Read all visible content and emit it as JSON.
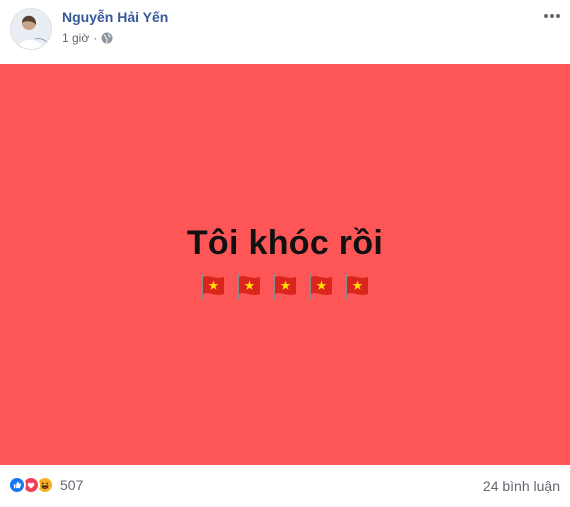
{
  "post": {
    "author": "Nguyễn Hải Yến",
    "timestamp": "1 giờ",
    "separator": "·",
    "privacy_icon": "globe-icon",
    "status_text": "Tôi khóc rồi",
    "flag_icon": "vietnam-flag-icon",
    "flag_count": 5,
    "background_color": "#fe5656"
  },
  "reactions": {
    "icons": [
      "like-icon",
      "love-icon",
      "haha-icon"
    ],
    "count": "507"
  },
  "comments": {
    "label": "24 bình luận"
  }
}
